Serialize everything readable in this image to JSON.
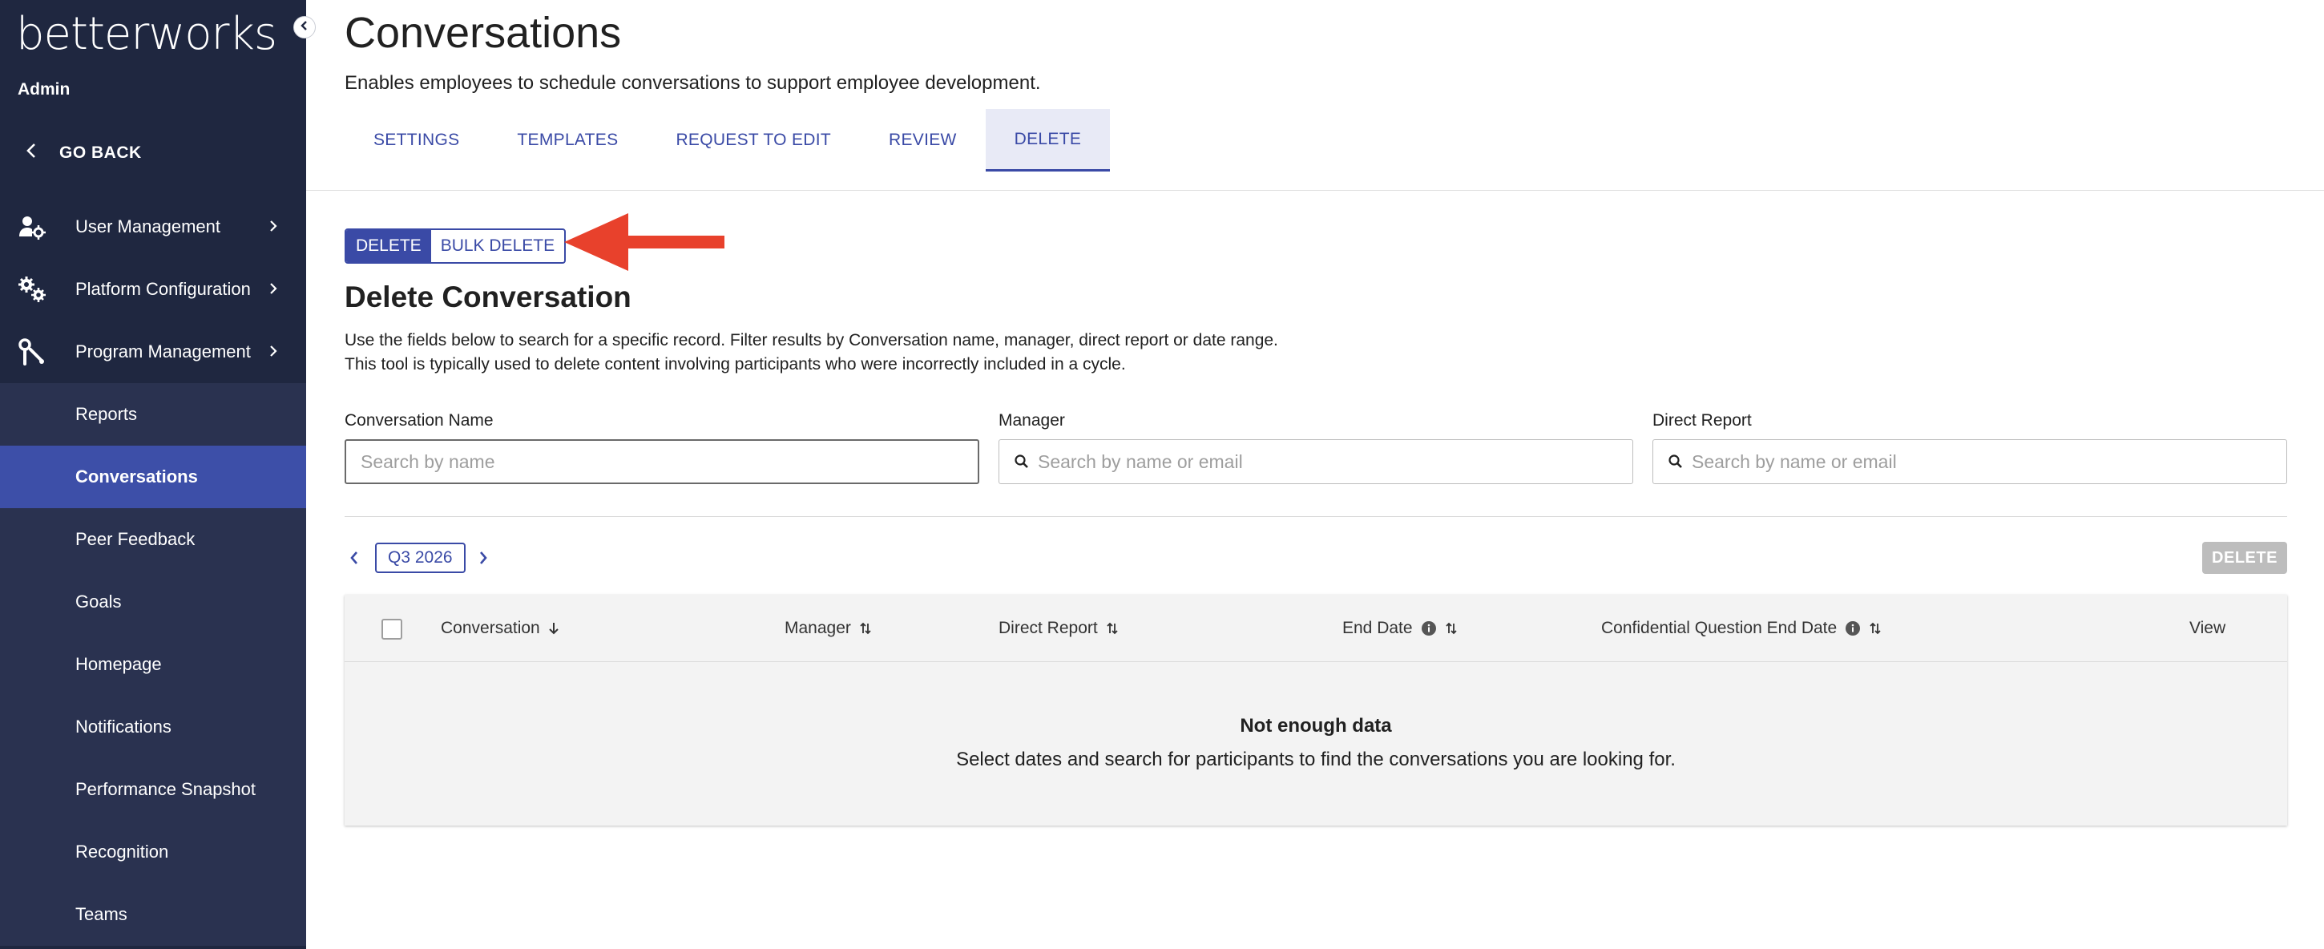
{
  "sidebar": {
    "logo": "betterworks",
    "section_label": "Admin",
    "go_back": "GO BACK",
    "main_items": [
      {
        "label": "User Management",
        "icon": "user-gear-icon"
      },
      {
        "label": "Platform Configuration",
        "icon": "gears-icon"
      },
      {
        "label": "Program Management",
        "icon": "tools-icon"
      }
    ],
    "sub_items": [
      {
        "label": "Reports"
      },
      {
        "label": "Conversations",
        "active": true
      },
      {
        "label": "Peer Feedback"
      },
      {
        "label": "Goals"
      },
      {
        "label": "Homepage"
      },
      {
        "label": "Notifications"
      },
      {
        "label": "Performance Snapshot"
      },
      {
        "label": "Recognition"
      },
      {
        "label": "Teams"
      }
    ]
  },
  "header": {
    "title": "Conversations",
    "subtitle": "Enables employees to schedule conversations to support employee development."
  },
  "tabs": [
    {
      "label": "SETTINGS"
    },
    {
      "label": "TEMPLATES"
    },
    {
      "label": "REQUEST TO EDIT"
    },
    {
      "label": "REVIEW"
    },
    {
      "label": "DELETE",
      "active": true
    }
  ],
  "mode_toggle": {
    "options": [
      "DELETE",
      "BULK DELETE"
    ],
    "selected": "DELETE"
  },
  "section": {
    "title": "Delete Conversation",
    "description": "Use the fields below to search for a specific record. Filter results by Conversation name, manager, direct report or date range. This tool is typically used to delete content involving participants who were incorrectly included in a cycle."
  },
  "filters": {
    "conversation_name": {
      "label": "Conversation Name",
      "placeholder": "Search by name"
    },
    "manager": {
      "label": "Manager",
      "placeholder": "Search by name or email"
    },
    "direct_report": {
      "label": "Direct Report",
      "placeholder": "Search by name or email"
    }
  },
  "period": {
    "label": "Q3 2026"
  },
  "actions": {
    "delete": "DELETE"
  },
  "table": {
    "columns": [
      {
        "label": "Conversation",
        "sort": "desc"
      },
      {
        "label": "Manager",
        "sort": "both"
      },
      {
        "label": "Direct Report",
        "sort": "both"
      },
      {
        "label": "End Date",
        "sort": "both",
        "info": true
      },
      {
        "label": "Confidential Question End Date",
        "sort": "both",
        "info": true
      },
      {
        "label": "View"
      }
    ],
    "rows": [],
    "empty_title": "Not enough data",
    "empty_message": "Select dates and search for participants to find the conversations you are looking for."
  },
  "colors": {
    "sidebar_bg": "#1f2740",
    "sidebar_active": "#3d4fa8",
    "accent": "#3a4aa6",
    "annotation_arrow": "#e8412c"
  }
}
